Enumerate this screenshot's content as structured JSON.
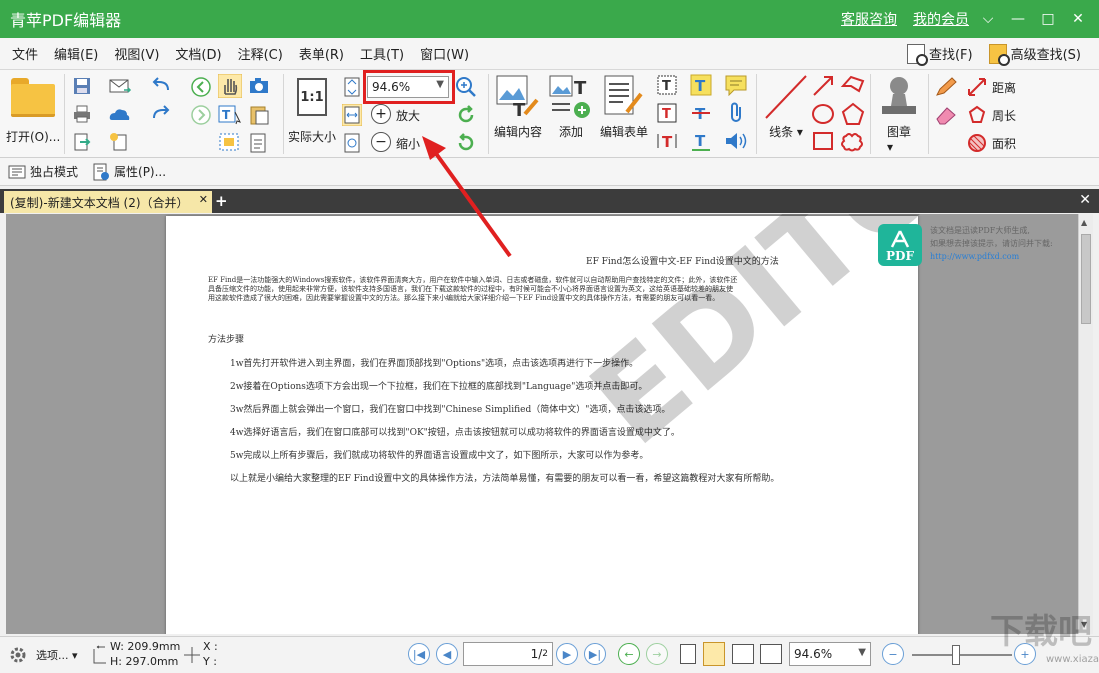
{
  "window": {
    "title": "青苹PDF编辑器",
    "support_link": "客服咨询",
    "member_link": "我的会员",
    "minimize": "—",
    "maximize": "□",
    "close": "✕"
  },
  "menu": {
    "items": [
      "文件",
      "编辑(E)",
      "视图(V)",
      "文档(D)",
      "注释(C)",
      "表单(R)",
      "工具(T)",
      "窗口(W)"
    ],
    "find": "查找(F)",
    "advanced_find": "高级查找(S)"
  },
  "ribbon": {
    "open": "打开(O)...",
    "actual_size": "实际大小",
    "zoom_value": "94.6%",
    "zoom_in": "放大",
    "zoom_out": "缩小",
    "edit_content": "编辑内容",
    "add": "添加",
    "edit_form": "编辑表单",
    "lines": "线条",
    "stamp": "图章",
    "distance": "距离",
    "perimeter": "周长",
    "area": "面积"
  },
  "subtoolbar": {
    "exclusive_mode": "独占模式",
    "properties": "属性(P)..."
  },
  "tabs": {
    "doc_tab": "(复制)-新建文本文档 (2)（合并）",
    "add": "+",
    "close": "✕"
  },
  "document": {
    "title": "EF Find怎么设置中文-EF Find设置中文的方法",
    "intro": "EF Find是一法功能强大的Windows搜索软件，该软件界面清爽大方，用户在软件中输入单词、日志或者磁盘，软件就可以自动帮助用户查找特定的文件；此外，该软件还具备压缩文件的功能，使用起来非常方便，该软件支持多国语言，我们在下载这款软件的过程中，有时候可能会不小心将界面语言设置为英文，这给英语基础较差的朋友使用这款软件造成了很大的困难，因此需要掌握设置中文的方法。那么接下来小编就给大家详细介绍一下EF Find设置中文的具体操作方法，有需要的朋友可以看一看。",
    "heading": "方法步骤",
    "steps": [
      "1w首先打开软件进入到主界面，我们在界面顶部找到\"Options\"选项，点击该选项再进行下一步操作。",
      "2w接着在Options选项下方会出现一个下拉框，我们在下拉框的底部找到\"Language\"选项并点击即可。",
      "3w然后界面上就会弹出一个窗口，我们在窗口中找到\"Chinese Simplified（简体中文）\"选项，点击该选项。",
      "4w选择好语言后，我们在窗口底部可以找到\"OK\"按钮，点击该按钮就可以成功将软件的界面语言设置成中文了。",
      "5w完成以上所有步骤后，我们就成功将软件的界面语言设置成中文了，如下图所示，大家可以作为参考。",
      "以上就是小编给大家整理的EF Find设置中文的具体操作方法，方法简单易懂，有需要的朋友可以看一看，希望这篇教程对大家有所帮助。"
    ],
    "watermark": "EDITOR",
    "badge_text": "PDF",
    "badge_note_1": "该文档是迅读PDF大师生成,",
    "badge_note_2": "如果想去掉该提示，请访问并下载:",
    "badge_url": "http://www.pdfxd.com"
  },
  "status": {
    "options": "选项...",
    "width": "W: 209.9mm",
    "height": "H: 297.0mm",
    "x": "X :",
    "y": "Y :",
    "page": "1",
    "page_total": "2",
    "zoom_value": "94.6%",
    "corner_watermark": "下载吧",
    "corner_url": "www.xiazaiba.com"
  },
  "colors": {
    "title_bar": "#3aa94b",
    "highlight": "#e02020",
    "accent_red": "#d32b2b"
  }
}
